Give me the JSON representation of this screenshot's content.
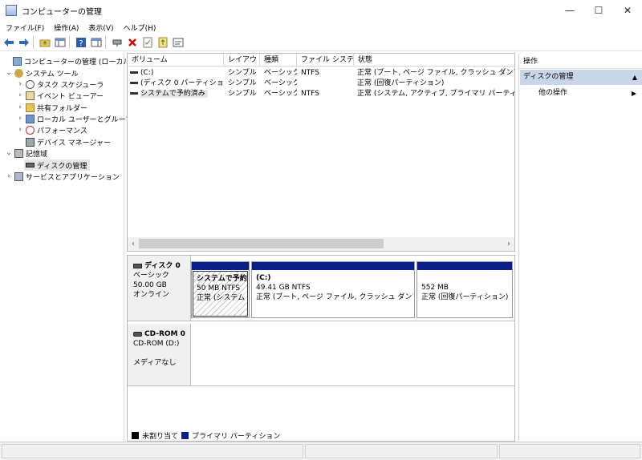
{
  "window": {
    "title": "コンピューターの管理",
    "controls": {
      "minimize": "—",
      "maximize": "☐",
      "close": "✕"
    }
  },
  "menu": [
    "ファイル(F)",
    "操作(A)",
    "表示(V)",
    "ヘルプ(H)"
  ],
  "toolbar": {
    "icons": [
      "back-icon",
      "forward-icon",
      "up-folder-icon",
      "show-hide-tree-icon",
      "help-icon",
      "properties-icon",
      "connect-icon",
      "delete-icon",
      "check-icon",
      "export-icon",
      "console-icon"
    ],
    "delete_color": "#d40000"
  },
  "tree": {
    "items": [
      {
        "label": "コンピューターの管理 (ローカル)",
        "indent": 0,
        "expander": "",
        "icon": "computer-icon"
      },
      {
        "label": "システム ツール",
        "indent": 1,
        "expander": "⌄",
        "icon": "tools-icon"
      },
      {
        "label": "タスク スケジューラ",
        "indent": 2,
        "expander": "›",
        "icon": "clock-icon"
      },
      {
        "label": "イベント ビューアー",
        "indent": 2,
        "expander": "›",
        "icon": "event-icon"
      },
      {
        "label": "共有フォルダー",
        "indent": 2,
        "expander": "›",
        "icon": "shared-folder-icon"
      },
      {
        "label": "ローカル ユーザーとグループ",
        "indent": 2,
        "expander": "›",
        "icon": "users-icon"
      },
      {
        "label": "パフォーマンス",
        "indent": 2,
        "expander": "›",
        "icon": "performance-icon"
      },
      {
        "label": "デバイス マネージャー",
        "indent": 2,
        "expander": "",
        "icon": "device-manager-icon"
      },
      {
        "label": "記憶域",
        "indent": 1,
        "expander": "⌄",
        "icon": "storage-icon"
      },
      {
        "label": "ディスクの管理",
        "indent": 2,
        "expander": "",
        "icon": "disk-icon",
        "selected": true
      },
      {
        "label": "サービスとアプリケーション",
        "indent": 1,
        "expander": "›",
        "icon": "services-icon"
      }
    ]
  },
  "volumes": {
    "columns": [
      "ボリューム",
      "レイアウト",
      "種類",
      "ファイル システム",
      "状態"
    ],
    "rows": [
      {
        "volume": "(C:)",
        "layout": "シンプル",
        "type": "ベーシック",
        "fs": "NTFS",
        "status": "正常 (ブート, ページ ファイル, クラッシュ ダンプ, プライマ"
      },
      {
        "volume": "(ディスク 0 パーティション 3)",
        "layout": "シンプル",
        "type": "ベーシック",
        "fs": "",
        "status": "正常 (回復パーティション)"
      },
      {
        "volume": "システムで予約済み",
        "layout": "シンプル",
        "type": "ベーシック",
        "fs": "NTFS",
        "status": "正常 (システム, アクティブ, プライマリ パーティション)"
      }
    ],
    "scroll_left": "‹",
    "scroll_right": "›"
  },
  "disks": [
    {
      "name": "ディスク 0",
      "type": "ベーシック",
      "size": "50.00 GB",
      "state": "オンライン",
      "partitions": [
        {
          "title": "システムで予約済",
          "size": "50 MB NTFS",
          "status": "正常 (システム"
        },
        {
          "title": "(C:)",
          "size": "49.41 GB NTFS",
          "status": "正常 (ブート, ページ ファイル, クラッシュ ダンプ, プライ"
        },
        {
          "title": "",
          "size": "552 MB",
          "status": "正常 (回復パーティション)"
        }
      ]
    },
    {
      "name": "CD-ROM 0",
      "type": "CD-ROM (D:)",
      "state": "メディアなし"
    }
  ],
  "legend": [
    {
      "label": "未割り当て",
      "color": "#000000"
    },
    {
      "label": "プライマリ パーティション",
      "color": "#0a1f8c"
    }
  ],
  "actions": {
    "header": "操作",
    "section": "ディスクの管理",
    "section_arrow": "▲",
    "item": "他の操作",
    "item_arrow": "▶"
  }
}
